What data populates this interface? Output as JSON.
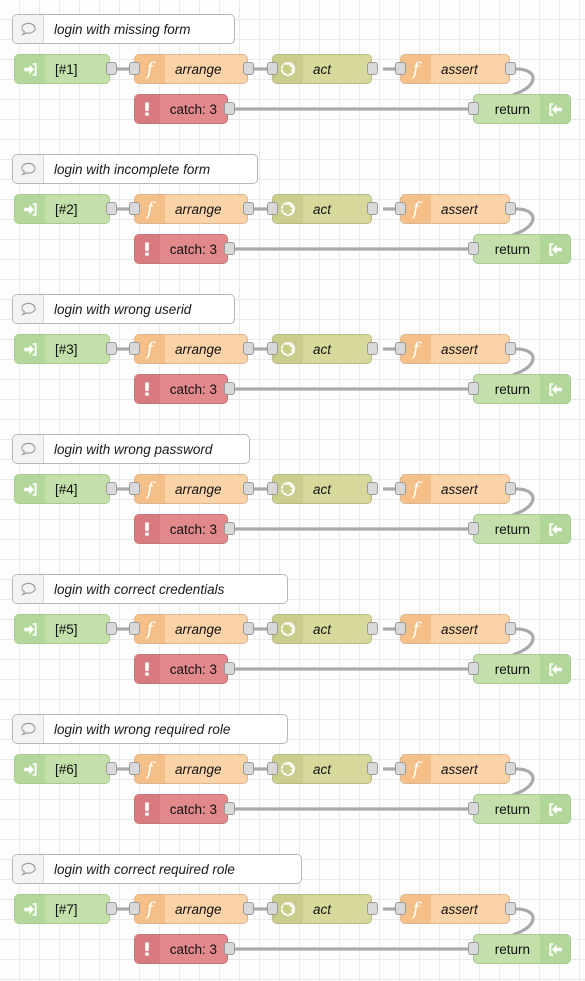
{
  "editor": {
    "name": "node-red-flow-canvas",
    "grid_size": 20,
    "background_color": "#fdfdfd",
    "grid_color": "#eaeaea",
    "wire_color": "#aaaaaa"
  },
  "palette_colors": {
    "inject": "#c3e0ab",
    "function": "#fbd3a9",
    "http_request": "#d7d99c",
    "catch": "#e2898b",
    "return": "#c3e0ab",
    "comment": "#ffffff"
  },
  "node_labels": {
    "arrange": "arrange",
    "act": "act",
    "assert": "assert",
    "catch": "catch: 3",
    "return": "return"
  },
  "icons": {
    "comment": "speech-bubble-icon",
    "inject": "arrow-into-bracket-icon",
    "function": "function-f-icon",
    "http_request": "globe-icon",
    "catch": "exclamation-mark-icon",
    "return": "arrow-out-of-bracket-icon"
  },
  "flows": [
    {
      "comment": "login with missing form",
      "inject_label": "[#1]",
      "arrange_label": "arrange",
      "act_label": "act",
      "assert_label": "assert",
      "catch_label": "catch: 3",
      "return_label": "return"
    },
    {
      "comment": "login with incomplete form",
      "inject_label": "[#2]",
      "arrange_label": "arrange",
      "act_label": "act",
      "assert_label": "assert",
      "catch_label": "catch: 3",
      "return_label": "return"
    },
    {
      "comment": "login with wrong userid",
      "inject_label": "[#3]",
      "arrange_label": "arrange",
      "act_label": "act",
      "assert_label": "assert",
      "catch_label": "catch: 3",
      "return_label": "return"
    },
    {
      "comment": "login with wrong password",
      "inject_label": "[#4]",
      "arrange_label": "arrange",
      "act_label": "act",
      "assert_label": "assert",
      "catch_label": "catch: 3",
      "return_label": "return"
    },
    {
      "comment": "login with correct credentials",
      "inject_label": "[#5]",
      "arrange_label": "arrange",
      "act_label": "act",
      "assert_label": "assert",
      "catch_label": "catch: 3",
      "return_label": "return"
    },
    {
      "comment": "login with wrong required role",
      "inject_label": "[#6]",
      "arrange_label": "arrange",
      "act_label": "act",
      "assert_label": "assert",
      "catch_label": "catch: 3",
      "return_label": "return"
    },
    {
      "comment": "login with correct required role",
      "inject_label": "[#7]",
      "arrange_label": "arrange",
      "act_label": "act",
      "assert_label": "assert",
      "catch_label": "catch: 3",
      "return_label": "return"
    }
  ]
}
